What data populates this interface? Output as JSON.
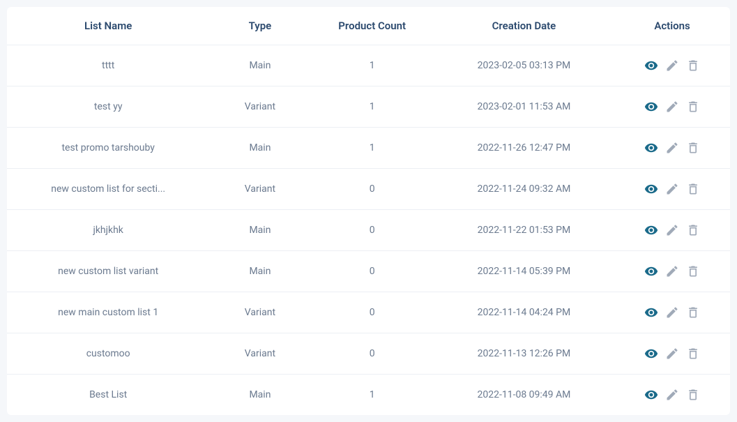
{
  "headers": {
    "name": "List Name",
    "type": "Type",
    "count": "Product Count",
    "date": "Creation Date",
    "actions": "Actions"
  },
  "rows": [
    {
      "name": "tttt",
      "type": "Main",
      "count": "1",
      "date": "2023-02-05 03:13 PM"
    },
    {
      "name": "test yy",
      "type": "Variant",
      "count": "1",
      "date": "2023-02-01 11:53 AM"
    },
    {
      "name": "test promo tarshouby",
      "type": "Main",
      "count": "1",
      "date": "2022-11-26 12:47 PM"
    },
    {
      "name": "new custom list for secti...",
      "type": "Variant",
      "count": "0",
      "date": "2022-11-24 09:32 AM"
    },
    {
      "name": "jkhjkhk",
      "type": "Main",
      "count": "0",
      "date": "2022-11-22 01:53 PM"
    },
    {
      "name": "new custom list variant",
      "type": "Main",
      "count": "0",
      "date": "2022-11-14 05:39 PM"
    },
    {
      "name": "new main custom list 1",
      "type": "Variant",
      "count": "0",
      "date": "2022-11-14 04:24 PM"
    },
    {
      "name": "customoo",
      "type": "Variant",
      "count": "0",
      "date": "2022-11-13 12:26 PM"
    },
    {
      "name": "Best List",
      "type": "Main",
      "count": "1",
      "date": "2022-11-08 09:49 AM"
    }
  ]
}
